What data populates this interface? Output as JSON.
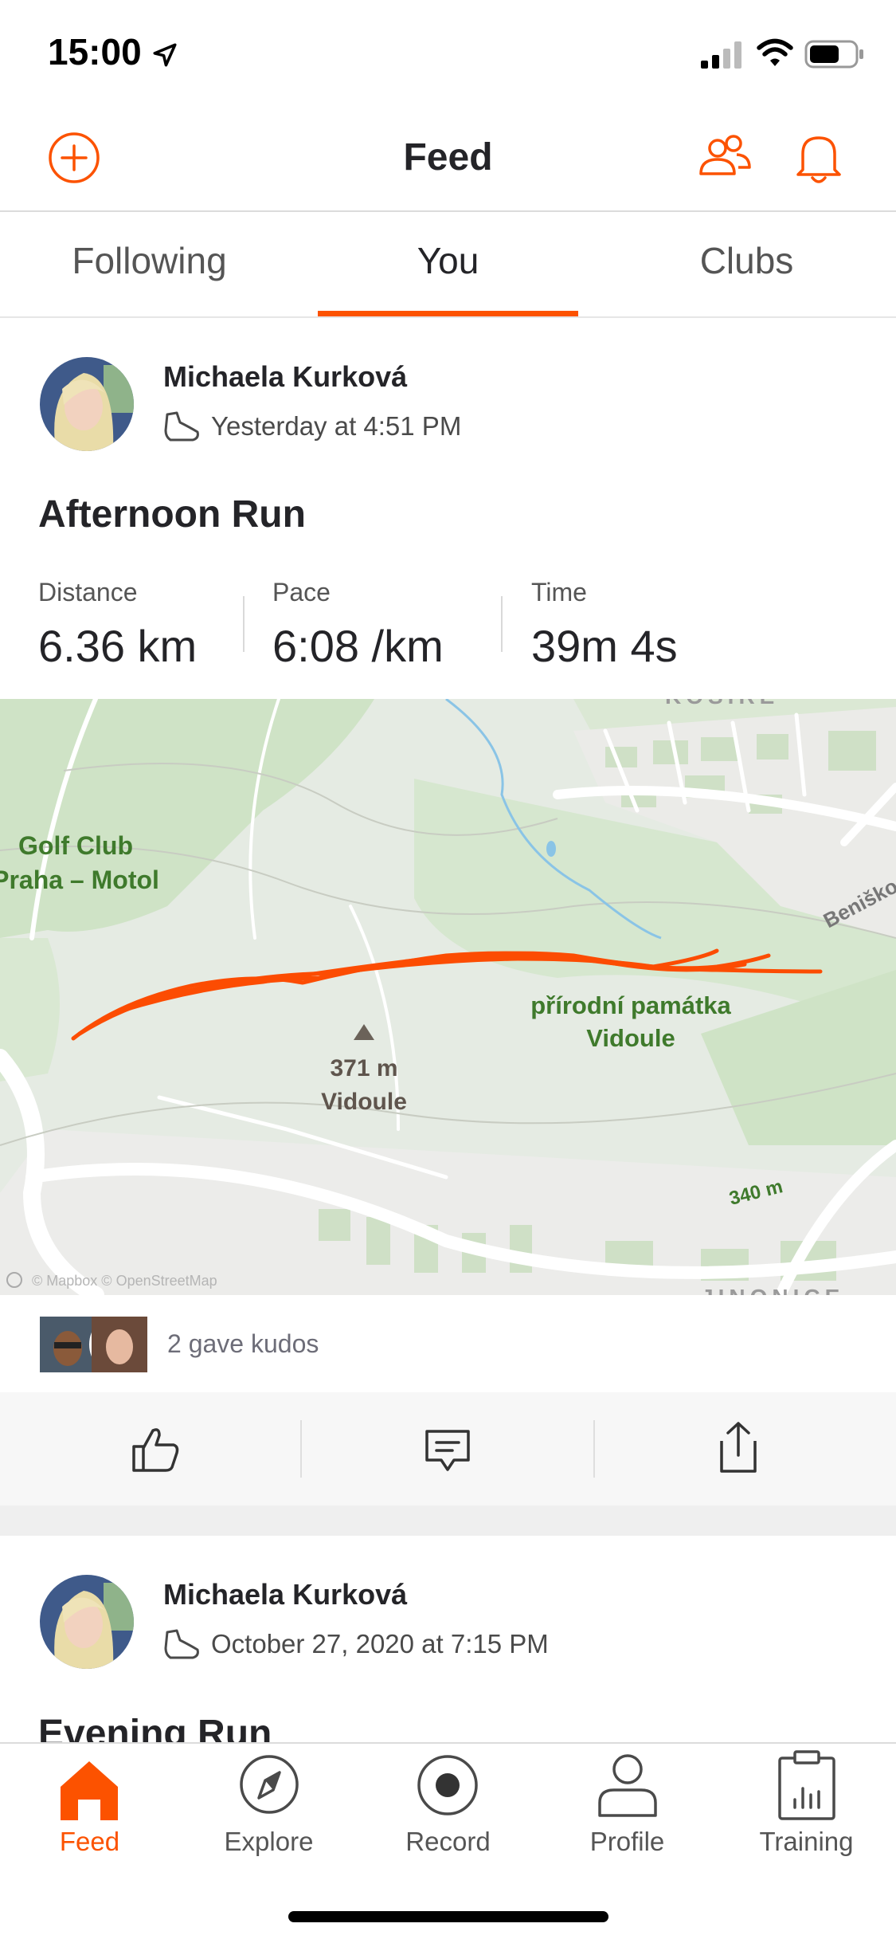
{
  "status_bar": {
    "time": "15:00"
  },
  "header": {
    "title": "Feed"
  },
  "tabs": [
    {
      "label": "Following",
      "active": false
    },
    {
      "label": "You",
      "active": true
    },
    {
      "label": "Clubs",
      "active": false
    }
  ],
  "post1": {
    "athlete_name": "Michaela Kurková",
    "timestamp": "Yesterday at 4:51 PM",
    "title": "Afternoon Run",
    "stats": [
      {
        "label": "Distance",
        "value": "6.36 km"
      },
      {
        "label": "Pace",
        "value": "6:08 /km"
      },
      {
        "label": "Time",
        "value": "39m 4s"
      }
    ],
    "map": {
      "labels": {
        "golf_line1": "Golf Club",
        "golf_line2": "Praha – Motol",
        "peak_elev": "371 m",
        "peak_name": "Vidoule",
        "reserve_line1": "přírodní památka",
        "reserve_line2": "Vidoule",
        "contour": "340 m",
        "street": "Beniško",
        "district_top": "KOSIŘE",
        "district_bottom": "JINONICE",
        "attribution": "© Mapbox © OpenStreetMap"
      },
      "route_color": "#fc4c02"
    },
    "kudos_text": "2 gave kudos"
  },
  "post2": {
    "athlete_name": "Michaela Kurková",
    "timestamp": "October 27, 2020 at 7:15 PM",
    "title": "Evening Run"
  },
  "tab_bar": [
    {
      "label": "Feed",
      "icon": "home-icon",
      "active": true
    },
    {
      "label": "Explore",
      "icon": "compass-icon",
      "active": false
    },
    {
      "label": "Record",
      "icon": "record-icon",
      "active": false
    },
    {
      "label": "Profile",
      "icon": "profile-icon",
      "active": false
    },
    {
      "label": "Training",
      "icon": "training-icon",
      "active": false
    }
  ],
  "colors": {
    "accent": "#fc5200",
    "text": "#242428",
    "map_bg": "#e6ece4"
  }
}
